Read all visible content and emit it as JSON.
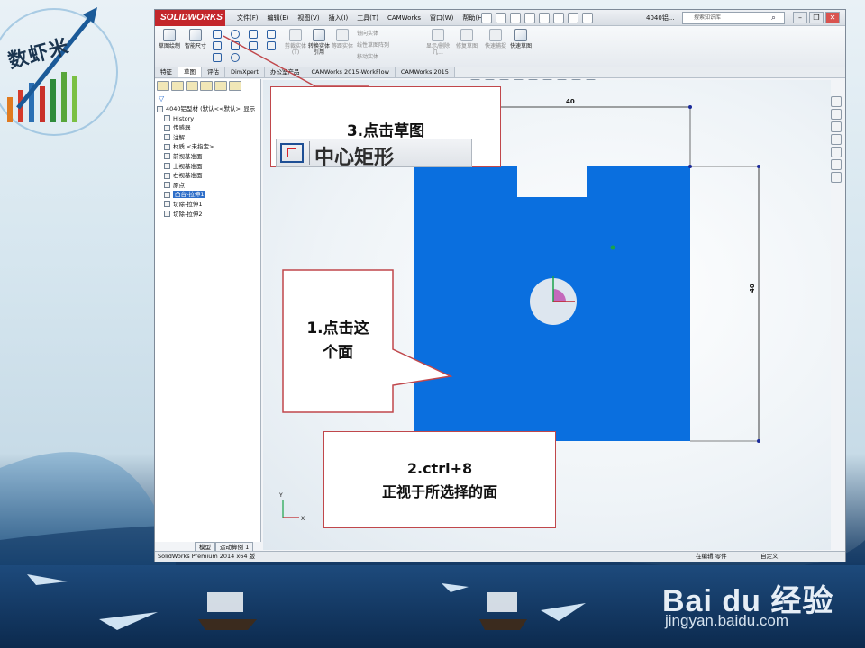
{
  "slide": {
    "logo_text": "数虾米",
    "baidu_brand": "Bai du 经验",
    "baidu_url": "jingyan.baidu.com"
  },
  "window": {
    "app_logo": "SOLIDWORKS",
    "menu": [
      "文件(F)",
      "编辑(E)",
      "视图(V)",
      "插入(I)",
      "工具(T)",
      "CAMWorks",
      "窗口(W)",
      "帮助(H)"
    ],
    "doc_title": "4040铝...",
    "search_placeholder": "搜索知识库"
  },
  "ribbon": {
    "buttons": [
      {
        "label": "草图绘制",
        "enabled": true
      },
      {
        "label": "智能尺寸",
        "enabled": true
      },
      {
        "label": "剪裁实体(T)",
        "enabled": false
      },
      {
        "label": "转换实体引用",
        "enabled": true
      },
      {
        "label": "等距实体",
        "enabled": false
      },
      {
        "label": "显示/删除几...",
        "enabled": false
      },
      {
        "label": "修复草图",
        "enabled": false
      },
      {
        "label": "快速捕捉",
        "enabled": false
      },
      {
        "label": "快速草图",
        "enabled": true
      }
    ],
    "small_items": [
      "镜向实体",
      "线性草图阵列",
      "移动实体"
    ]
  },
  "tabs": [
    "特征",
    "草图",
    "评估",
    "DimXpert",
    "办公室产品",
    "CAMWorks 2015-WorkFlow",
    "CAMWorks 2015"
  ],
  "active_tab": "草图",
  "tree": {
    "root": "4040铝型材 (默认<<默认>_显示",
    "items": [
      {
        "label": "History",
        "selected": false
      },
      {
        "label": "传感器",
        "selected": false
      },
      {
        "label": "注解",
        "selected": false
      },
      {
        "label": "材质 <未指定>",
        "selected": false
      },
      {
        "label": "前视基准面",
        "selected": false
      },
      {
        "label": "上视基准面",
        "selected": false
      },
      {
        "label": "右视基准面",
        "selected": false
      },
      {
        "label": "原点",
        "selected": false
      },
      {
        "label": "凸台-拉伸1",
        "selected": true
      },
      {
        "label": "切除-拉伸1",
        "selected": false
      },
      {
        "label": "切除-拉伸2",
        "selected": false
      }
    ],
    "bottom_tabs": [
      "模型",
      "运动算例 1"
    ]
  },
  "status": {
    "left": "SolidWorks Premium 2014 x64 版",
    "mode": "在编辑 零件",
    "units": "自定义"
  },
  "drawing": {
    "dim_top": "40",
    "dim_right": "40",
    "face_color": "#0a6fdf",
    "axis_labels": [
      "Y",
      "X"
    ]
  },
  "callouts": {
    "step3": "3.点击草图",
    "center_rect_label": "中心矩形",
    "step1_line1": "1.点击这",
    "step1_line2": "个面",
    "step2_line1": "2.ctrl+8",
    "step2_line2": "正视于所选择的面"
  },
  "colors": {
    "accent_red": "#c0474b",
    "tree_selection": "#2f6fc9",
    "app_red": "#c3262b"
  }
}
